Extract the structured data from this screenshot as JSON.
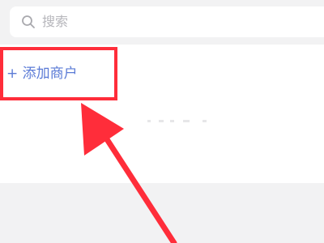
{
  "search": {
    "placeholder": "搜索",
    "icon": "search-icon"
  },
  "merchant": {
    "add_label": "+ 添加商户"
  },
  "colors": {
    "accent": "#5b7bd6",
    "highlight": "#ff2d3a",
    "background": "#f2f2f3"
  }
}
